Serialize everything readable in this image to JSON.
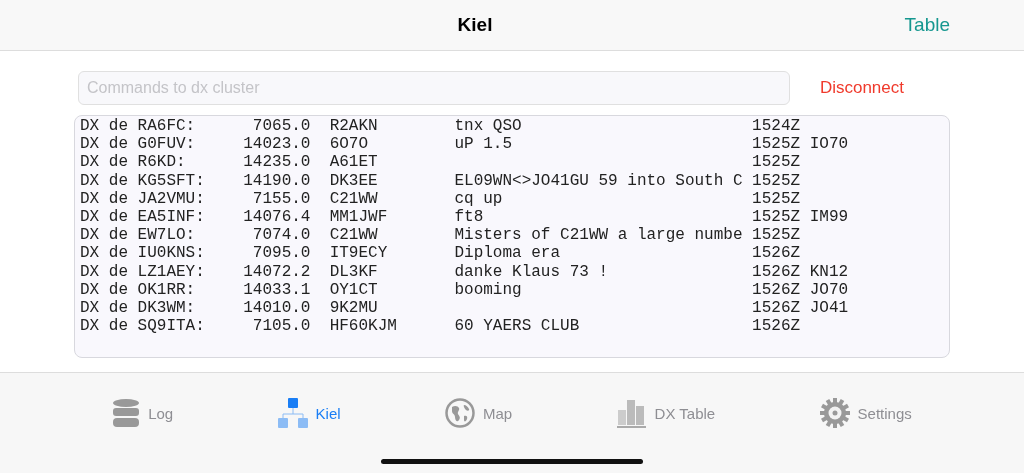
{
  "nav": {
    "title": "Kiel",
    "action": "Table"
  },
  "command": {
    "placeholder": "Commands to dx cluster",
    "button": "Disconnect"
  },
  "spots": [
    {
      "spotter": "DX de RA6FC:",
      "freq": "7065.0",
      "call": "R2AKN",
      "comment": "tnx QSO",
      "time": "1524Z"
    },
    {
      "spotter": "DX de G0FUV:",
      "freq": "14023.0",
      "call": "6O7O",
      "comment": "uP 1.5",
      "time": "1525Z",
      "grid": "IO70"
    },
    {
      "spotter": "DX de R6KD:",
      "freq": "14235.0",
      "call": "A61ET",
      "time": "1525Z"
    },
    {
      "spotter": "DX de KG5SFT:",
      "freq": "14190.0",
      "call": "DK3EE",
      "comment": "EL09WN<>JO41GU 59 into South C",
      "time": "1525Z"
    },
    {
      "spotter": "DX de JA2VMU:",
      "freq": "7155.0",
      "call": "C21WW",
      "comment": "cq up",
      "time": "1525Z"
    },
    {
      "spotter": "DX de EA5INF:",
      "freq": "14076.4",
      "call": "MM1JWF",
      "comment": "ft8",
      "time": "1525Z",
      "grid": "IM99"
    },
    {
      "spotter": "DX de EW7LO:",
      "freq": "7074.0",
      "call": "C21WW",
      "comment": "Misters of C21WW a large numbe",
      "time": "1525Z"
    },
    {
      "spotter": "DX de IU0KNS:",
      "freq": "7095.0",
      "call": "IT9ECY",
      "comment": "Diploma era",
      "time": "1526Z"
    },
    {
      "spotter": "DX de LZ1AEY:",
      "freq": "14072.2",
      "call": "DL3KF",
      "comment": "danke Klaus 73 !",
      "time": "1526Z",
      "grid": "KN12"
    },
    {
      "spotter": "DX de OK1RR:",
      "freq": "14033.1",
      "call": "OY1CT",
      "comment": "booming",
      "time": "1526Z",
      "grid": "JO70"
    },
    {
      "spotter": "DX de DK3WM:",
      "freq": "14010.0",
      "call": "9K2MU",
      "time": "1526Z",
      "grid": "JO41"
    },
    {
      "spotter": "DX de SQ9ITA:",
      "freq": "7105.0",
      "call": "HF60KJM",
      "comment": "60 YAERS CLUB",
      "time": "1526Z"
    }
  ],
  "tabs": [
    {
      "label": "Log",
      "kind": "database",
      "selected": false
    },
    {
      "label": "Kiel",
      "kind": "network",
      "selected": true
    },
    {
      "label": "Map",
      "kind": "globe",
      "selected": false
    },
    {
      "label": "DX Table",
      "kind": "chart",
      "selected": false
    },
    {
      "label": "Settings",
      "kind": "gear",
      "selected": false
    }
  ]
}
